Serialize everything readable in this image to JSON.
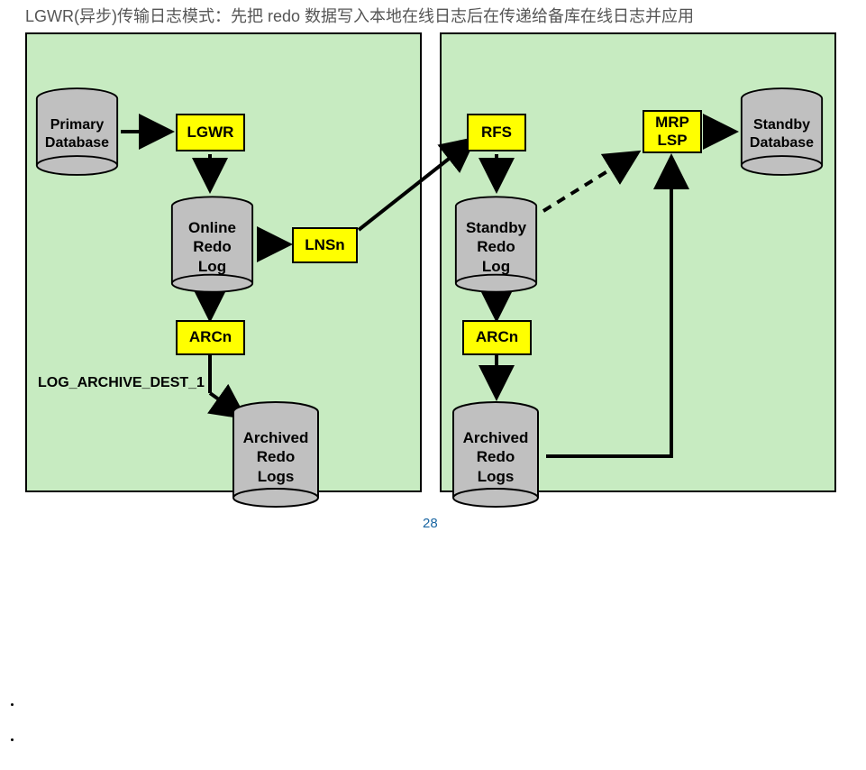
{
  "caption": "LGWR(异步)传输日志模式：先把 redo 数据写入本地在线日志后在传递给备库在线日志并应用",
  "titles": {
    "primary": "Primary Database",
    "standby": "Standby Database"
  },
  "primary": {
    "db": "Primary\nDatabase",
    "lgwr": "LGWR",
    "online_redo": "Online\nRedo\nLog",
    "lnsn": "LNSn",
    "arcn": "ARCn",
    "arch_dest": "LOG_ARCHIVE_DEST_1",
    "archived": "Archived\nRedo\nLogs"
  },
  "standby": {
    "rfs": "RFS",
    "mrp_lsp": "MRP\nLSP",
    "db": "Standby\nDatabase",
    "srl": "Standby\nRedo\nLog",
    "arcn": "ARCn",
    "archived": "Archived\nRedo\nLogs"
  },
  "page_number": "28"
}
